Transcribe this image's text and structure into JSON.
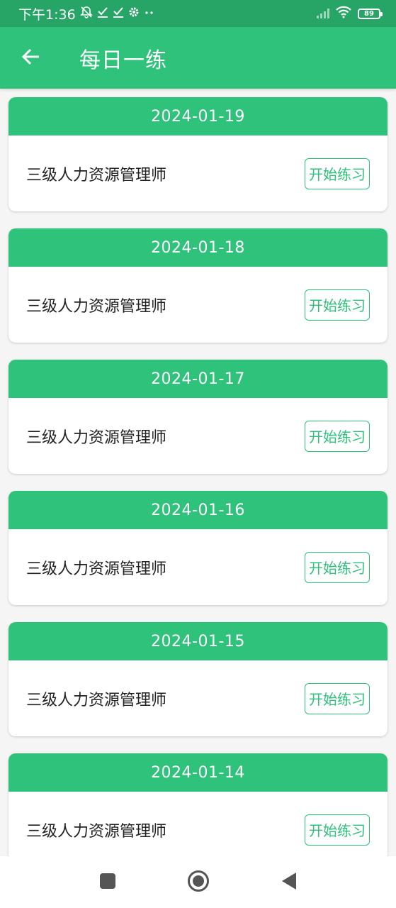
{
  "status_bar": {
    "time": "下午1:36",
    "icons": [
      "mute-bell-icon",
      "check-icon",
      "check-icon",
      "gear-icon",
      "more-icon"
    ],
    "battery": "89"
  },
  "header": {
    "title": "每日一练",
    "back_icon": "arrow-left-icon"
  },
  "colors": {
    "primary": "#2ec27a",
    "status_bar": "#27a566",
    "background": "#f5f5f5"
  },
  "cards": [
    {
      "date": "2024-01-19",
      "name": "三级人力资源管理师",
      "button": "开始练习"
    },
    {
      "date": "2024-01-18",
      "name": "三级人力资源管理师",
      "button": "开始练习"
    },
    {
      "date": "2024-01-17",
      "name": "三级人力资源管理师",
      "button": "开始练习"
    },
    {
      "date": "2024-01-16",
      "name": "三级人力资源管理师",
      "button": "开始练习"
    },
    {
      "date": "2024-01-15",
      "name": "三级人力资源管理师",
      "button": "开始练习"
    },
    {
      "date": "2024-01-14",
      "name": "三级人力资源管理师",
      "button": "开始练习"
    }
  ],
  "nav_bar": [
    "recents-square-icon",
    "home-circle-icon",
    "back-triangle-icon"
  ]
}
